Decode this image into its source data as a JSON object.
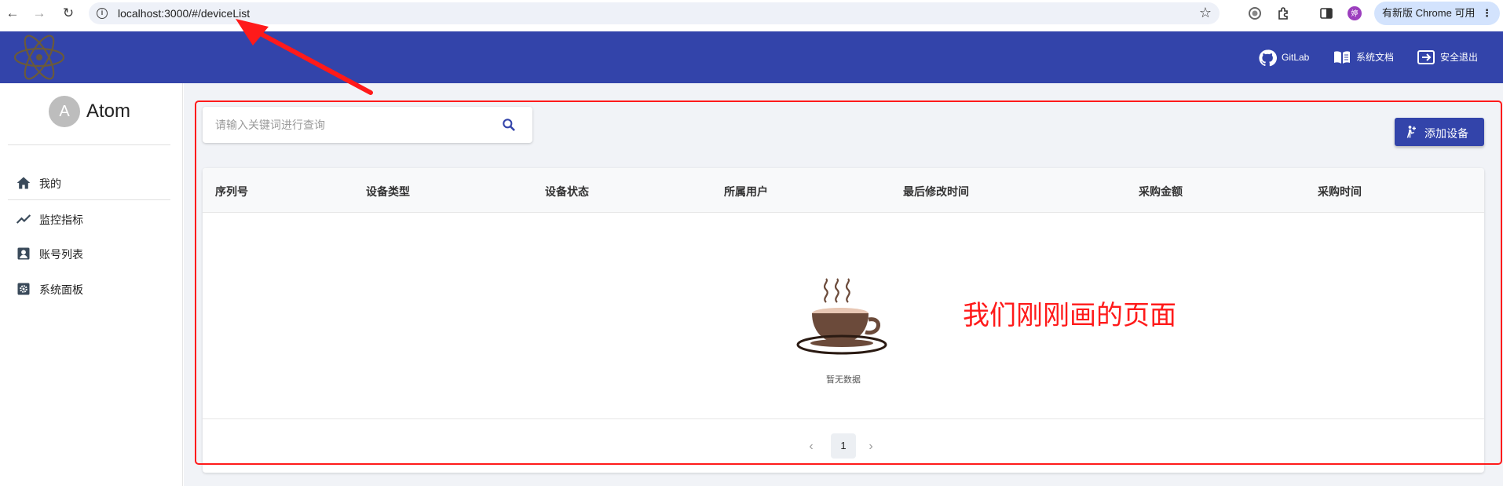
{
  "browser": {
    "url": "localhost:3000/#/deviceList",
    "update_label": "有新版 Chrome 可用",
    "profile_initial": "婷"
  },
  "header": {
    "links": [
      {
        "label": "GitLab",
        "icon": "github-icon"
      },
      {
        "label": "系统文档",
        "icon": "book-icon"
      },
      {
        "label": "安全退出",
        "icon": "logout-icon"
      }
    ]
  },
  "sidebar": {
    "avatar_initial": "A",
    "brand": "Atom",
    "items": [
      {
        "label": "我的",
        "icon": "home-icon"
      },
      {
        "label": "监控指标",
        "icon": "trend-icon"
      },
      {
        "label": "账号列表",
        "icon": "account-box-icon"
      },
      {
        "label": "系统面板",
        "icon": "settings-box-icon"
      }
    ]
  },
  "main": {
    "search_placeholder": "请输入关键词进行查询",
    "add_button": "添加设备",
    "columns": [
      "序列号",
      "设备类型",
      "设备状态",
      "所属用户",
      "最后修改时间",
      "采购金额",
      "采购时间"
    ],
    "empty_text": "暂无数据",
    "pagination": {
      "current_page": "1"
    }
  },
  "annotation": {
    "text": "我们刚刚画的页面"
  },
  "colors": {
    "header_bg": "#3344aa",
    "annotation": "#ff1a1a",
    "main_bg": "#f1f3f7"
  }
}
